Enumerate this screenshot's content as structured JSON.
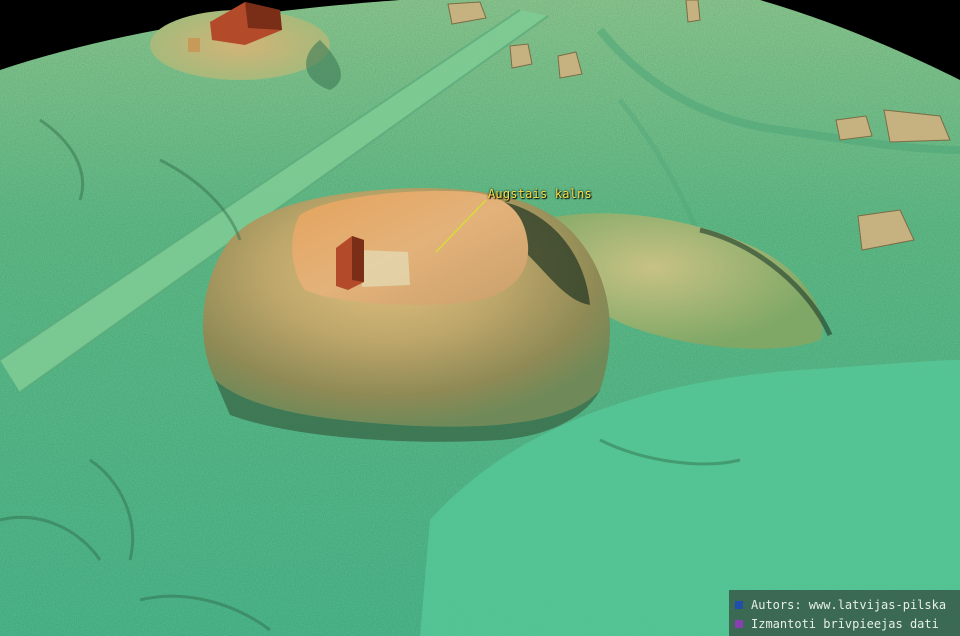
{
  "map": {
    "annotation": {
      "label": "Augstais kalns"
    },
    "credits": [
      {
        "text": "Autors: www.latvijas-pilska",
        "color": "#1f4fa8"
      },
      {
        "text": "Izmantoti brīvpieejas dati",
        "color": "#8a3fb0"
      }
    ],
    "colors": {
      "lowland": "#5fc98f",
      "hill": "#c9b47a",
      "hilltop": "#d9884a",
      "building_roof": "#b34a2a",
      "sky": "#000000"
    }
  }
}
